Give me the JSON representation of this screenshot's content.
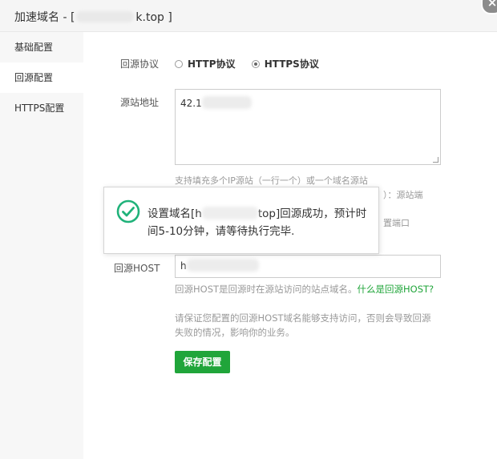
{
  "dialog": {
    "title_prefix": "加速域名 - [",
    "title_suffix": "k.top ]",
    "close_symbol": "×"
  },
  "sidebar": {
    "items": [
      {
        "label": "基础配置"
      },
      {
        "label": "回源配置"
      },
      {
        "label": "HTTPS配置"
      }
    ]
  },
  "form": {
    "protocol_label": "回源协议",
    "protocol_options": [
      {
        "label": "HTTP协议",
        "checked": false
      },
      {
        "label": "HTTPS协议",
        "checked": true
      }
    ],
    "origin_label": "源站地址",
    "origin_value": "42.1",
    "origin_hint_1": "支持填充多个IP源站（一行一个）或一个域名源站",
    "origin_hint_2_tail": "）：源站端",
    "origin_hint_3_tail": "置端口",
    "host_label": "回源HOST",
    "host_value": "h",
    "host_help": "回源HOST是回源时在源站访问的站点域名。",
    "host_help_link": "什么是回源HOST?",
    "host_warning": "请保证您配置的回源HOST域名能够支持访问，否则会导致回源失败的情况，影响你的业务。",
    "save_label": "保存配置"
  },
  "toast": {
    "text_prefix": "设置域名[h",
    "text_suffix": "top]回源成功，预计时间5-10分钟，请等待执行完毕."
  },
  "colors": {
    "accent": "#20a53a",
    "toast_icon": "#20b27a"
  }
}
